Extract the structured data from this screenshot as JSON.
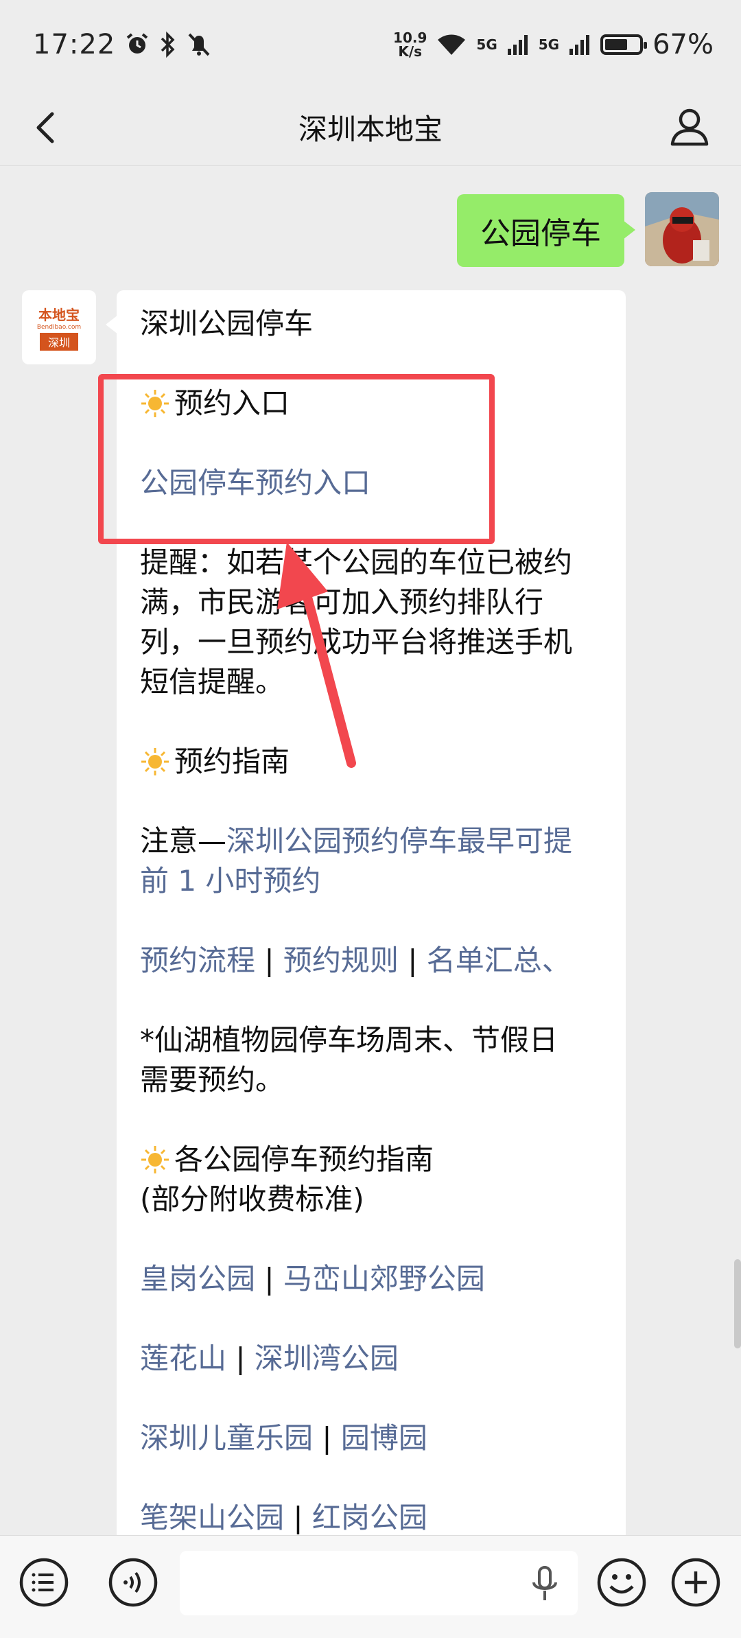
{
  "status_bar": {
    "time": "17:22",
    "net_speed_value": "10.9",
    "net_speed_unit": "K/s",
    "signal1": "5G",
    "signal2": "5G",
    "battery": "67%",
    "battery_level": 0.67
  },
  "header": {
    "title": "深圳本地宝"
  },
  "chat": {
    "user_message": "公园停车",
    "bot_avatar": {
      "logo_text": "本地宝",
      "logo_url": "Bendibao.com",
      "logo_city": "深圳"
    },
    "bot_message": {
      "title": "深圳公园停车",
      "section1_heading": "预约入口",
      "booking_link": "公园停车预约入口",
      "reminder_lines": [
        "提醒：如若某个公园的车位已被约",
        "满，市民游客可加入预约排队行",
        "列，一旦预约成功平台将推送手机",
        "短信提醒。"
      ],
      "section2_heading": "预约指南",
      "note_prefix": "注意—",
      "note_link_line1": "深圳公园预约停车最早可提",
      "note_link_line2": "前 1 小时预约",
      "guide_links": [
        "预约流程",
        "预约规则",
        "名单汇总、"
      ],
      "separator": "|",
      "xianhu_lines": [
        "*仙湖植物园停车场周末、节假日",
        "需要预约。"
      ],
      "section3_heading": "各公园停车预约指南",
      "section3_sub": "(部分附收费标准)",
      "park_rows": [
        [
          "皇岗公园",
          "马峦山郊野公园"
        ],
        [
          "莲花山",
          "深圳湾公园"
        ],
        [
          "深圳儿童乐园",
          "园博园"
        ],
        [
          "笔架山公园",
          "红岗公园"
        ]
      ]
    }
  },
  "colors": {
    "link": "#576b95",
    "user_bubble": "#95ec69",
    "highlight": "#f2474e"
  }
}
